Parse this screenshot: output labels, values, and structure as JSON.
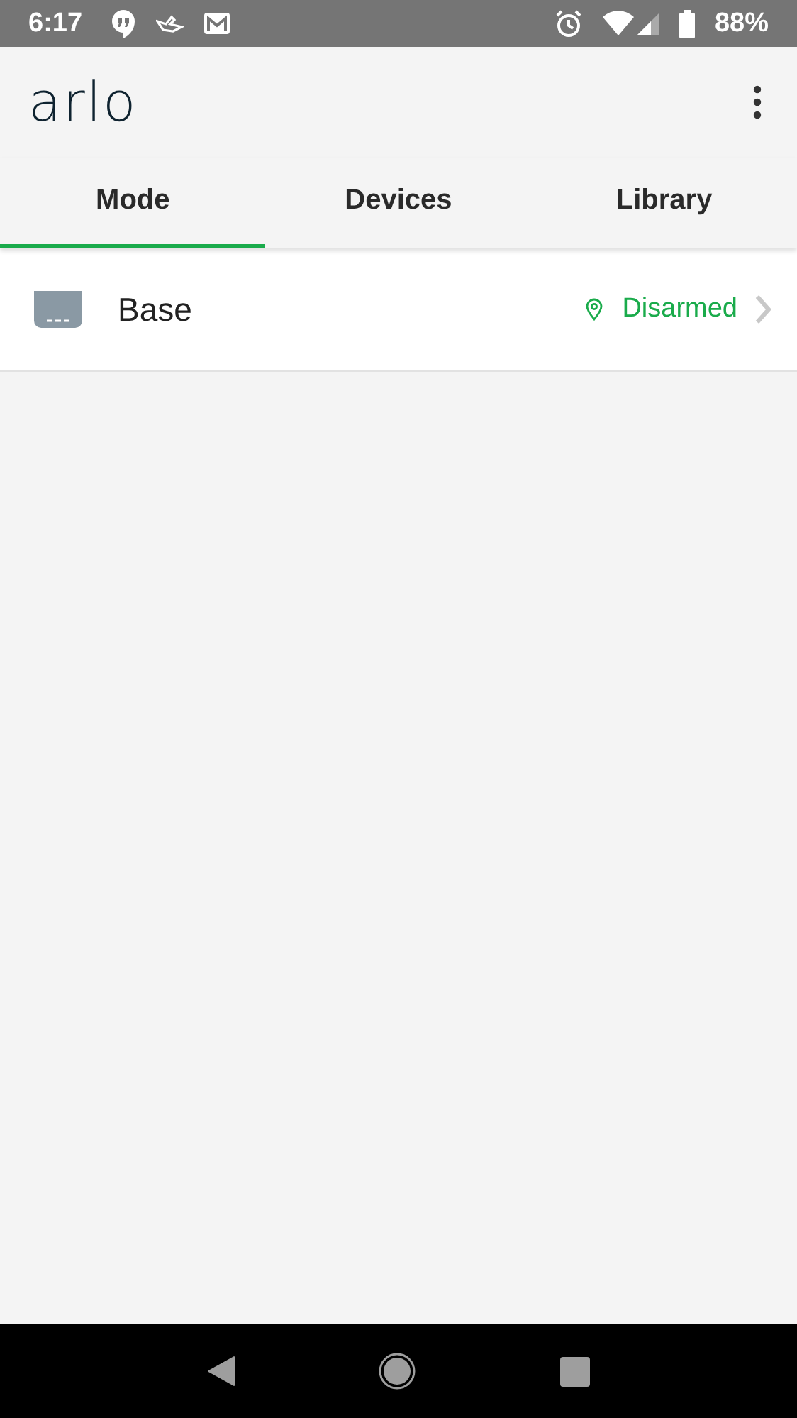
{
  "status_bar": {
    "time": "6:17",
    "battery": "88%"
  },
  "app_bar": {
    "title": "arlo"
  },
  "tabs": [
    {
      "label": "Mode",
      "selected": true
    },
    {
      "label": "Devices",
      "selected": false
    },
    {
      "label": "Library",
      "selected": false
    }
  ],
  "devices": [
    {
      "name": "Base",
      "mode": "Disarmed"
    }
  ]
}
